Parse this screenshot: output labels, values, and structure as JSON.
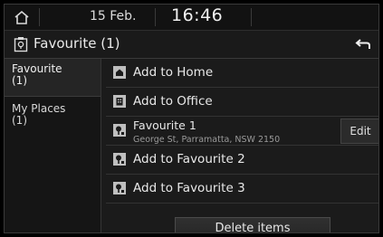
{
  "status_bar": {
    "home_icon": "home-icon",
    "date": "15 Feb.",
    "time": "16:46"
  },
  "header": {
    "icon": "favourite-place-icon",
    "title": "Favourite (1)",
    "back_icon": "back-arrow-icon"
  },
  "sidebar": {
    "items": [
      {
        "label": "Favourite\n(1)",
        "selected": true
      },
      {
        "label": "My Places\n(1)",
        "selected": false
      }
    ]
  },
  "list": {
    "items": [
      {
        "icon": "home-icon",
        "label": "Add to Home"
      },
      {
        "icon": "office-icon",
        "label": "Add to Office"
      },
      {
        "icon": "favourite-pin-icon",
        "label": "Favourite 1",
        "address": "George St, Parramatta, NSW 2150",
        "action": "Edit"
      },
      {
        "icon": "favourite-pin-icon",
        "label": "Add to Favourite 2"
      },
      {
        "icon": "favourite-pin-icon",
        "label": "Add to Favourite 3"
      }
    ],
    "delete_label": "Delete items"
  },
  "colors": {
    "background": "#1b1b1b",
    "text": "#e6e6e6",
    "divider": "#333333"
  }
}
